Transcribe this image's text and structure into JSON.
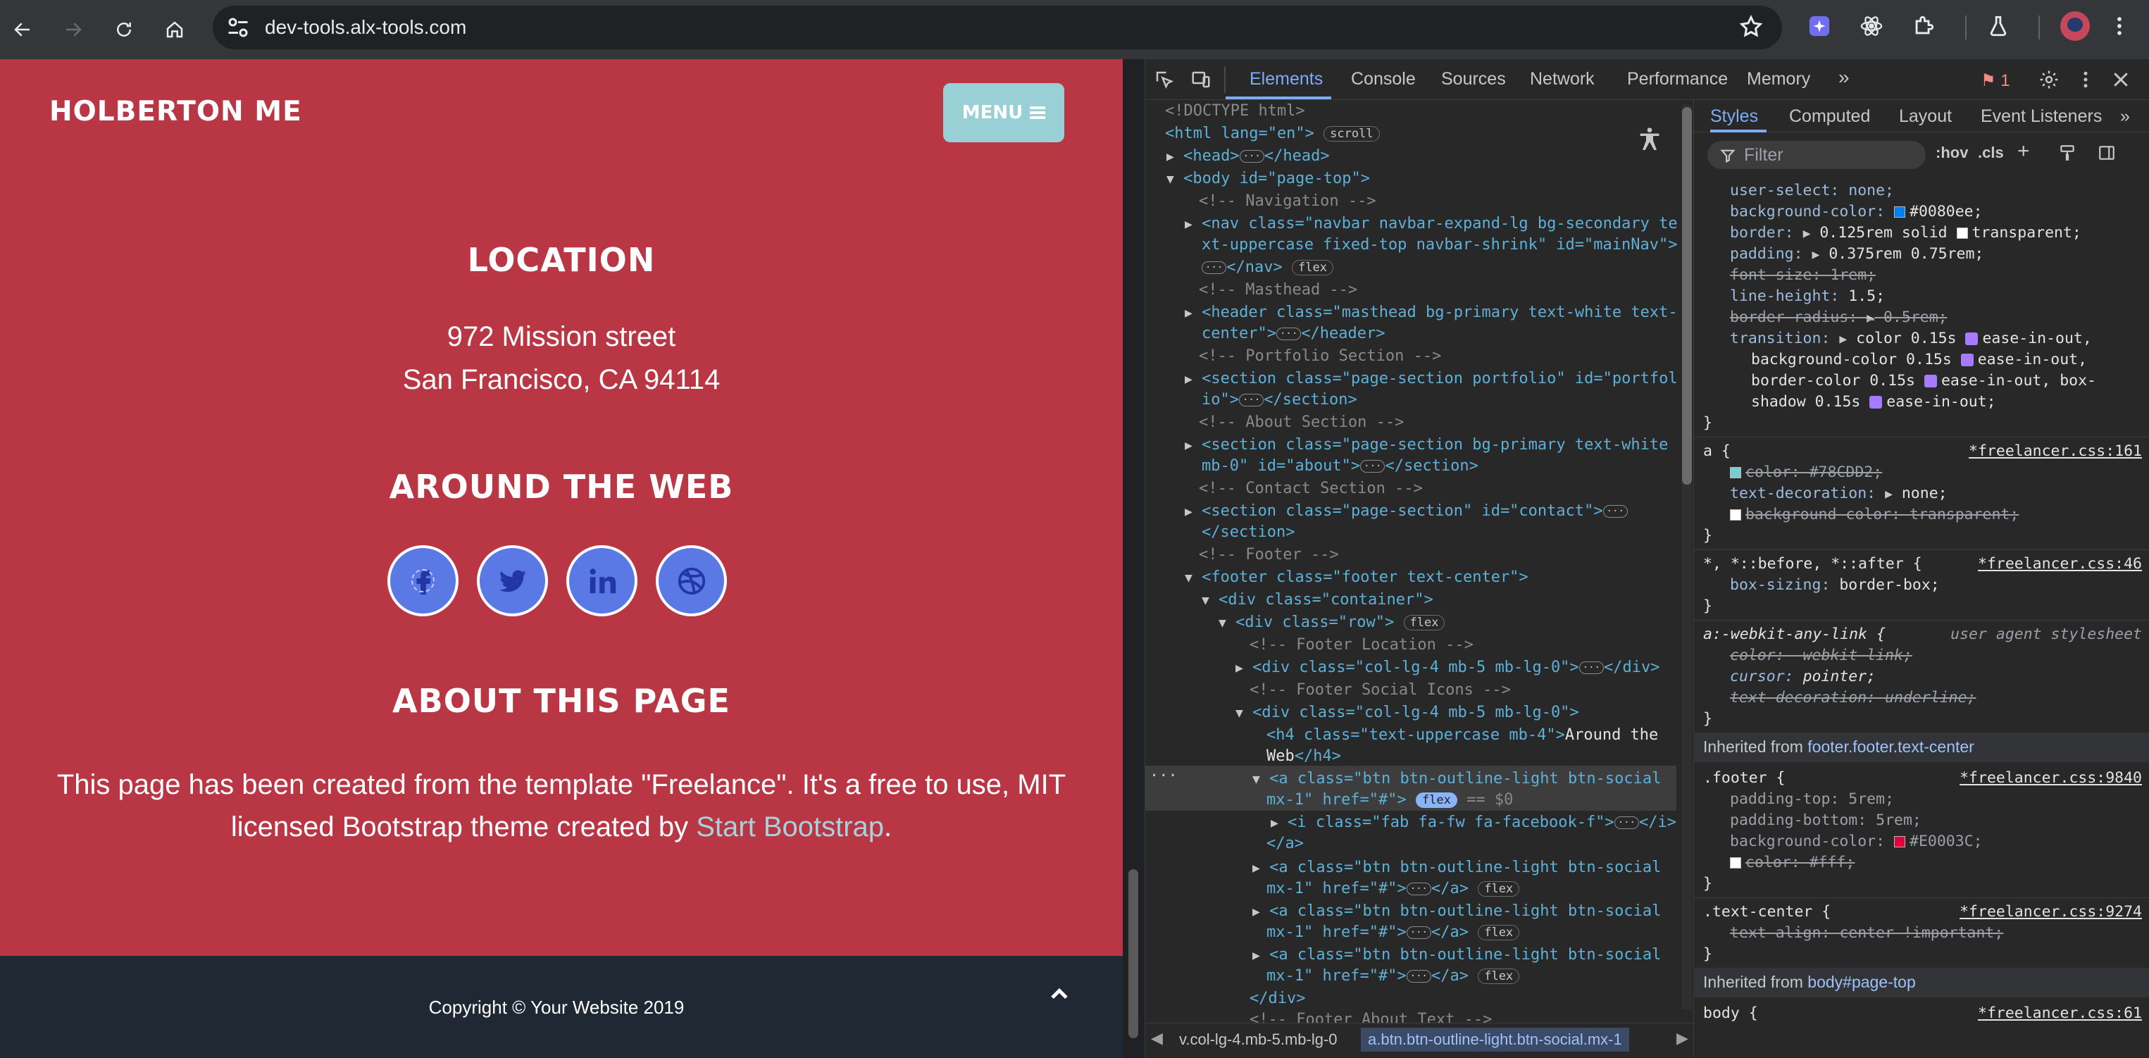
{
  "browser": {
    "url": "dev-tools.alx-tools.com"
  },
  "site": {
    "brand": "HOLBERTON ME",
    "menu_label": "MENU",
    "location_title": "LOCATION",
    "address_line1": "972 Mission street",
    "address_line2": "San Francisco, CA 94114",
    "web_title": "AROUND THE WEB",
    "social": [
      "facebook-icon",
      "twitter-icon",
      "linkedin-icon",
      "dribbble-icon"
    ],
    "about_title": "ABOUT THIS PAGE",
    "about_text": "This page has been created from the template \"Freelance\". It's a free to use, MIT licensed Bootstrap theme created by",
    "about_link": "Start Bootstrap",
    "about_end": ".",
    "copyright": "Copyright © Your Website 2019",
    "colors": {
      "primary": "#E0003C",
      "menu": "#78CDD2",
      "footer_bar": "#1f2833"
    }
  },
  "devtools": {
    "tabs": [
      "Elements",
      "Console",
      "Sources",
      "Network",
      "Performance",
      "Memory"
    ],
    "active_tab": "Elements",
    "issues_count": "1",
    "more_tabs": "»",
    "styles_tabs": [
      "Styles",
      "Computed",
      "Layout",
      "Event Listeners"
    ],
    "filter_placeholder": "Filter",
    "hov": ":hov",
    "cls": ".cls",
    "breadcrumb_1": "v.col-lg-4.mb-5.mb-lg-0",
    "breadcrumb_2": "a.btn.btn-outline-light.btn-social.mx-1",
    "dom": {
      "doctype": "<!DOCTYPE html>",
      "html_open": "<html lang=\"en\">",
      "scroll": "scroll",
      "head": "<head>",
      "head_close": "</head>",
      "body_open": "<body id=\"page-top\">",
      "c_nav": "<!-- Navigation -->",
      "nav_l1": "<nav class=\"navbar navbar-expand-lg bg-secondary te",
      "nav_l2": "xt-uppercase fixed-top navbar-shrink\" id=\"mainNav\">",
      "nav_close": "</nav>",
      "flex": "flex",
      "c_masthead": "<!-- Masthead -->",
      "header_l1": "<header class=\"masthead bg-primary text-white text-",
      "header_l2": "center\">",
      "header_close": "</header>",
      "c_portfolio": "<!-- Portfolio Section -->",
      "port_l1": "<section class=\"page-section portfolio\" id=\"portfol",
      "port_l2": "io\">",
      "section_close": "</section>",
      "c_about": "<!-- About Section -->",
      "about_l1": "<section class=\"page-section bg-primary text-white",
      "about_l2": "mb-0\" id=\"about\">",
      "c_contact": "<!-- Contact Section -->",
      "contact_l1": "<section class=\"page-section\" id=\"contact\">",
      "c_footer": "<!-- Footer -->",
      "footer_open": "<footer class=\"footer text-center\">",
      "container_open": "<div class=\"container\">",
      "row_open": "<div class=\"row\">",
      "c_fl": "<!-- Footer Location -->",
      "col_collapsed": "<div class=\"col-lg-4 mb-5 mb-lg-0\">",
      "div_close": "</div>",
      "c_fs": "<!-- Footer Social Icons -->",
      "col_open": "<div class=\"col-lg-4 mb-5 mb-lg-0\">",
      "h4_open": "<h4 class=\"text-uppercase mb-4\">",
      "h4_text1": "Around the",
      "h4_text2": "Web",
      "h4_close": "</h4>",
      "a_l1": "<a class=\"btn btn-outline-light btn-social",
      "a_l2": "mx-1\" href=\"#\">",
      "a_close": "</a>",
      "eq0": "== $0",
      "i_l1": "<i class=\"fab fa-fw fa-facebook-f\">",
      "i_close": "</i>",
      "c_fat": "<!-- Footer About Text -->"
    },
    "styles": {
      "r1": {
        "l0": "user-select: none;",
        "bg_name": "background-color:",
        "bg_val": "#0080ee;",
        "border_name": "border:",
        "border_val1": "0.125rem solid",
        "border_val2": "transparent;",
        "padding_name": "padding:",
        "padding_val": "0.375rem 0.75rem;",
        "fs": "font-size: 1rem;",
        "lh_name": "line-height:",
        "lh_val": "1.5;",
        "br_name": "border-radius:",
        "br_val": "0.5rem;",
        "tr_name": "transition:",
        "tr_1": "color 0.15s",
        "tr_1b": "ease-in-out,",
        "tr_2": "background-color 0.15s",
        "tr_2b": "ease-in-out,",
        "tr_3": "border-color 0.15s",
        "tr_3b": "ease-in-out, box-",
        "tr_4": "shadow 0.15s",
        "tr_4b": "ease-in-out;",
        "close": "}"
      },
      "r2": {
        "sel": "a {",
        "src": "*freelancer.css:161",
        "color": "color: #78CDD2;",
        "td_name": "text-decoration:",
        "td_val": "none;",
        "bg": "background-color: transparent;",
        "close": "}"
      },
      "r3": {
        "sel": "*, *::before, *::after {",
        "src": "*freelancer.css:46",
        "bs_name": "box-sizing:",
        "bs_val": "border-box;",
        "close": "}"
      },
      "r4": {
        "sel": "a:-webkit-any-link {",
        "src": "user agent stylesheet",
        "color": "color: -webkit-link;",
        "cursor_name": "cursor:",
        "cursor_val": "pointer;",
        "td": "text-decoration: underline;",
        "close": "}"
      },
      "inherited1_label": "Inherited from",
      "inherited1_link": "footer.footer.text-center",
      "r5": {
        "sel": ".footer {",
        "src": "*freelancer.css:9840",
        "pt_name": "padding-top:",
        "pt_val": "5rem;",
        "pb_name": "padding-bottom:",
        "pb_val": "5rem;",
        "bg_name": "background-color:",
        "bg_val": "#E0003C;",
        "color": "color: #fff;",
        "close": "}"
      },
      "r6": {
        "sel": ".text-center {",
        "src": "*freelancer.css:9274",
        "ta": "text-align: center !important;",
        "close": "}"
      },
      "inherited2_label": "Inherited from",
      "inherited2_link": "body#page-top",
      "r7": {
        "sel": "body {",
        "src": "*freelancer.css:61"
      }
    }
  }
}
